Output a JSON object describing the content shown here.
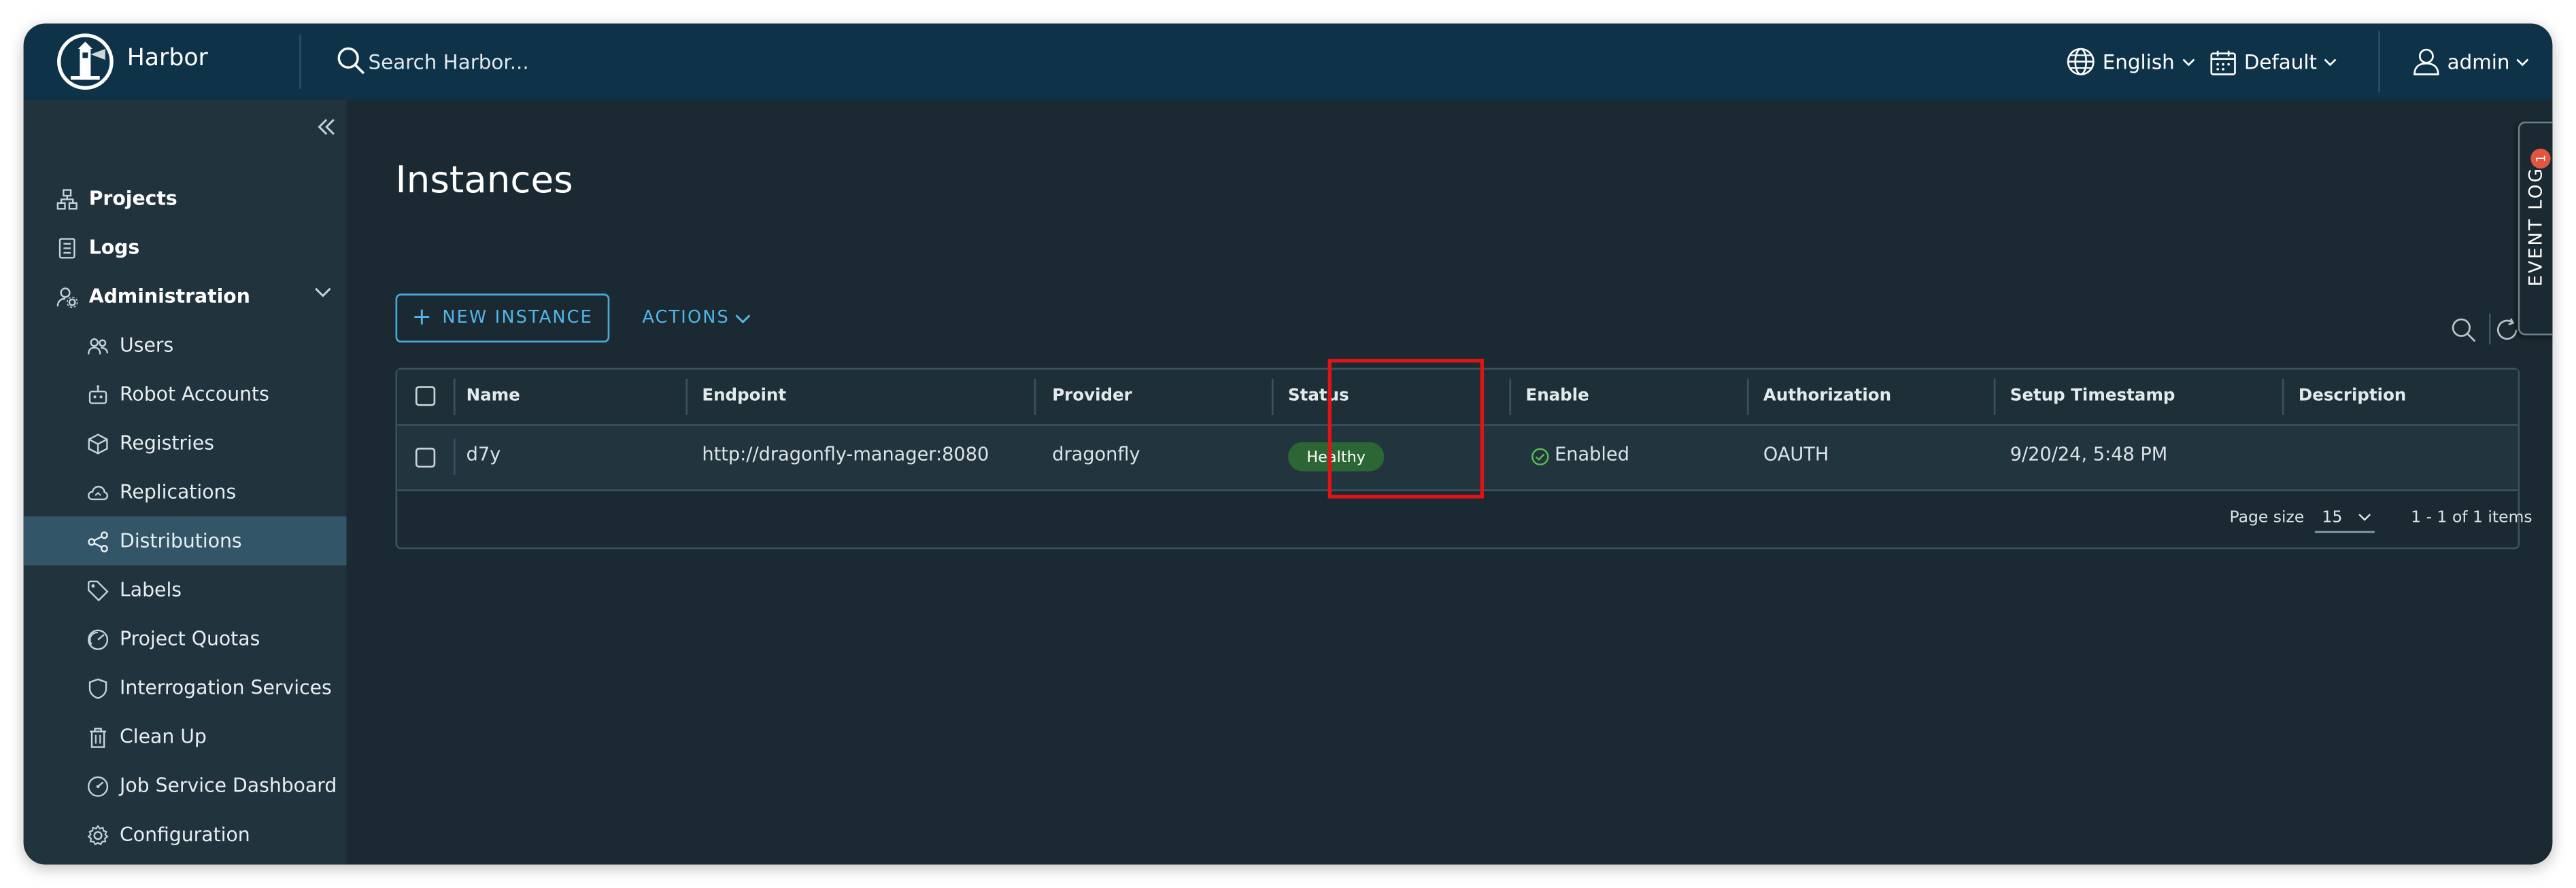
{
  "header": {
    "brand": "Harbor",
    "search_placeholder": "Search Harbor...",
    "language": "English",
    "theme": "Default",
    "user": "admin"
  },
  "sidebar": {
    "items": [
      {
        "label": "Projects",
        "icon": "projects-icon"
      },
      {
        "label": "Logs",
        "icon": "logs-icon"
      },
      {
        "label": "Administration",
        "icon": "administration-icon"
      },
      {
        "label": "Users",
        "icon": "users-icon"
      },
      {
        "label": "Robot Accounts",
        "icon": "robot-icon"
      },
      {
        "label": "Registries",
        "icon": "registries-icon"
      },
      {
        "label": "Replications",
        "icon": "replications-icon"
      },
      {
        "label": "Distributions",
        "icon": "distributions-icon"
      },
      {
        "label": "Labels",
        "icon": "labels-icon"
      },
      {
        "label": "Project Quotas",
        "icon": "quotas-icon"
      },
      {
        "label": "Interrogation Services",
        "icon": "shield-icon"
      },
      {
        "label": "Clean Up",
        "icon": "trash-icon"
      },
      {
        "label": "Job Service Dashboard",
        "icon": "dashboard-icon"
      },
      {
        "label": "Configuration",
        "icon": "gear-icon"
      }
    ],
    "active": "Distributions"
  },
  "main": {
    "title": "Instances",
    "new_instance": "NEW INSTANCE",
    "actions": "ACTIONS",
    "columns": [
      "Name",
      "Endpoint",
      "Provider",
      "Status",
      "Enable",
      "Authorization",
      "Setup Timestamp",
      "Description"
    ],
    "rows": [
      {
        "name": "d7y",
        "endpoint": "http://dragonfly-manager:8080",
        "provider": "dragonfly",
        "status": "Healthy",
        "enable": "Enabled",
        "authorization": "OAUTH",
        "setup_timestamp": "9/20/24, 5:48 PM",
        "description": ""
      }
    ],
    "page_size_label": "Page size",
    "page_size": "15",
    "count": "1 - 1 of 1 items"
  },
  "event_log": {
    "label": "EVENT LOG",
    "count": "1"
  },
  "colors": {
    "header_bg": "#0e3349",
    "sidebar_bg": "#21333d",
    "main_bg": "#1b2a32",
    "accent": "#52b6e8",
    "healthy": "#2b6634",
    "highlight": "#e01414"
  }
}
